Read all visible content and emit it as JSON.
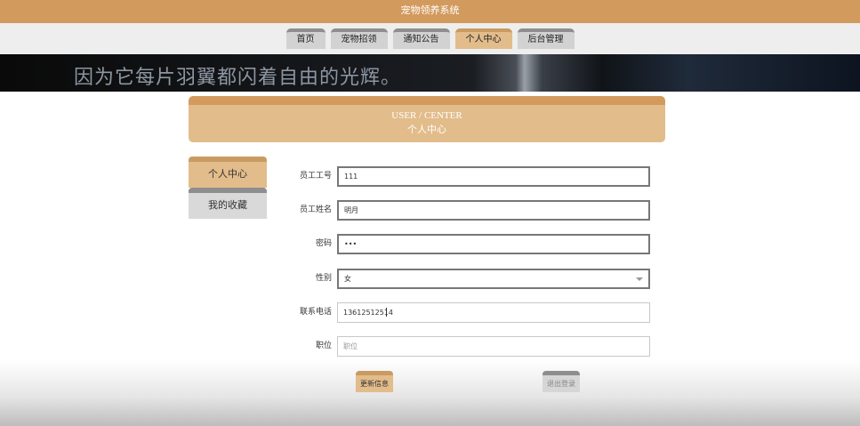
{
  "app": {
    "title": "宠物领养系统"
  },
  "nav": {
    "items": [
      {
        "label": "首页"
      },
      {
        "label": "宠物招领"
      },
      {
        "label": "通知公告"
      },
      {
        "label": "个人中心"
      },
      {
        "label": "后台管理"
      }
    ],
    "active": "个人中心"
  },
  "banner": {
    "text": "因为它每片羽翼都闪着自由的光辉。"
  },
  "header": {
    "en": "USER / CENTER",
    "cn": "个人中心"
  },
  "side_menu": {
    "items": [
      {
        "label": "个人中心"
      },
      {
        "label": "我的收藏"
      }
    ]
  },
  "form": {
    "employee_no": {
      "label": "员工工号",
      "value": "111"
    },
    "employee_name": {
      "label": "员工姓名",
      "value": "明月"
    },
    "password": {
      "label": "密码",
      "value": "•••"
    },
    "gender": {
      "label": "性别",
      "value": "女"
    },
    "phone": {
      "label": "联系电话",
      "value": "13612512514"
    },
    "position": {
      "label": "职位",
      "placeholder": "职位"
    }
  },
  "buttons": {
    "update": "更新信息",
    "logout": "退出登录"
  },
  "colors": {
    "brand": "#d39a5e",
    "accent_light": "#e2bc8a",
    "nav_bg": "#eeeeee"
  }
}
